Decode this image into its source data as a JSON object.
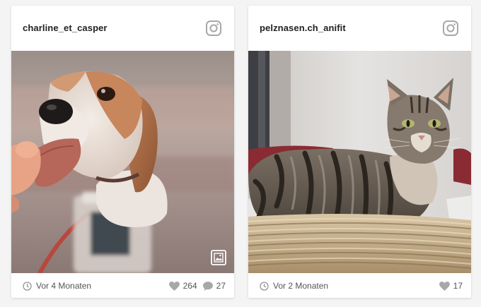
{
  "posts": [
    {
      "username": "charline_et_casper",
      "time_ago": "Vor 4 Monaten",
      "likes": "264",
      "comments": "27",
      "photo_subject": "beagle-treat-photo",
      "has_gallery_badge": true
    },
    {
      "username": "pelznasen.ch_anifit",
      "time_ago": "Vor 2 Monaten",
      "likes": "17",
      "photo_subject": "tabby-cat-basket-photo",
      "has_gallery_badge": false
    }
  ],
  "colors": {
    "icon_gray": "#a8a8a8",
    "text": "#222222",
    "meta_text": "#555555"
  }
}
